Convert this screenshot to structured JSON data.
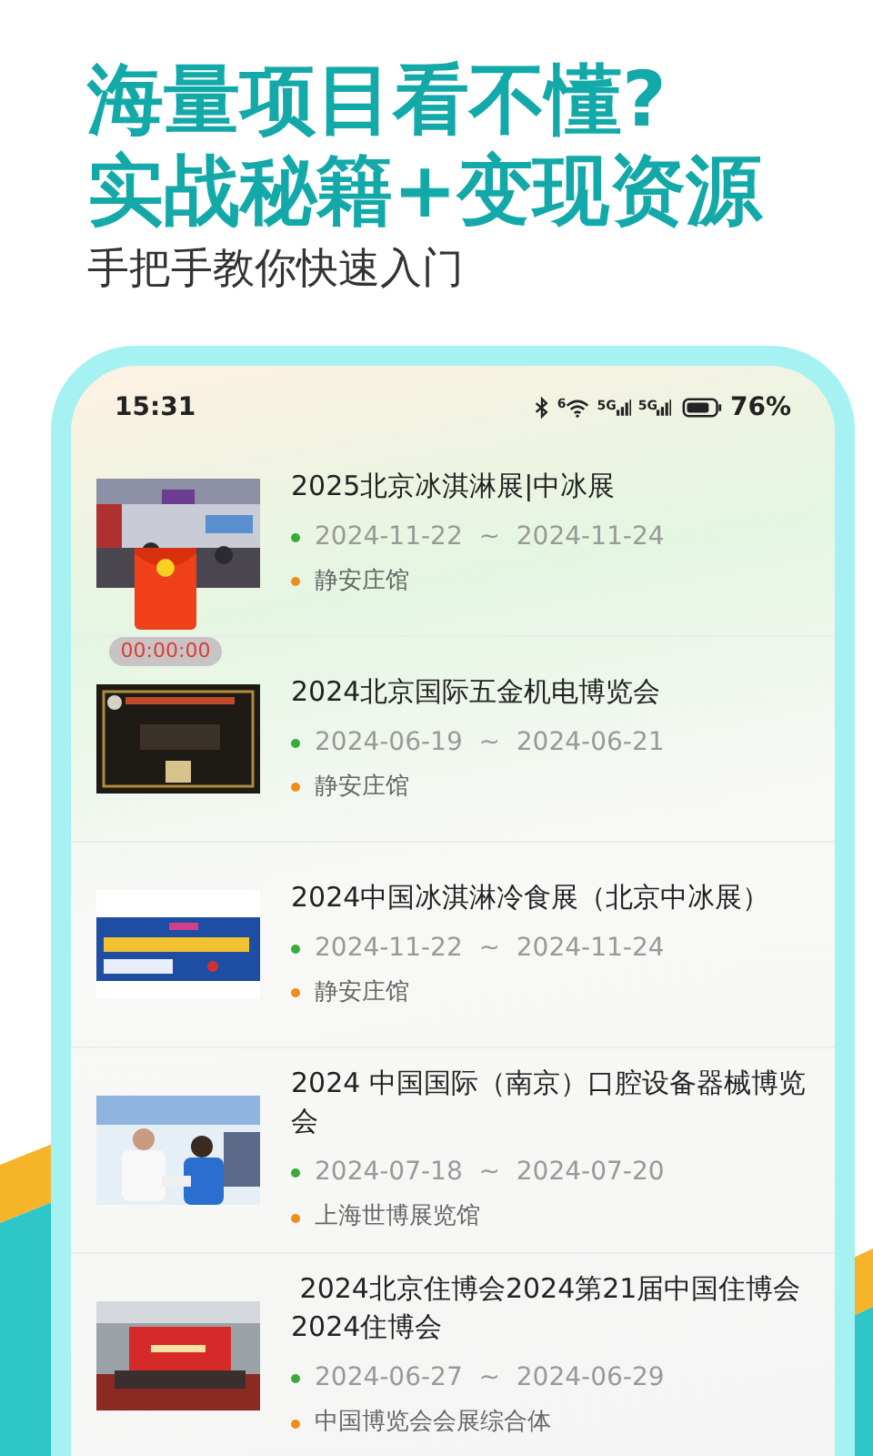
{
  "headline": {
    "lines": [
      "海量项目看不懂?",
      "实战秘籍+变现资源"
    ],
    "subtitle": "手把手教你快速入门"
  },
  "status_bar": {
    "time": "15:31",
    "wifi_badge": "6",
    "signals": [
      "5G",
      "5G"
    ],
    "battery": "76%"
  },
  "events": [
    {
      "title": "2025北京冰淇淋展|中冰展",
      "start": "2024-11-22",
      "separator": "~",
      "end": "2024-11-24",
      "venue": "静安庄馆",
      "red_packet": {
        "timer": "00:00:00"
      }
    },
    {
      "title": "2024北京国际五金机电博览会",
      "start": "2024-06-19",
      "separator": "~",
      "end": "2024-06-21",
      "venue": "静安庄馆"
    },
    {
      "title": "2024中国冰淇淋冷食展（北京中冰展）",
      "start": "2024-11-22",
      "separator": "~",
      "end": "2024-11-24",
      "venue": "静安庄馆"
    },
    {
      "title": "2024 中国国际（南京）口腔设备器械博览会",
      "start": "2024-07-18",
      "separator": "~",
      "end": "2024-07-20",
      "venue": "上海世博展览馆"
    },
    {
      "title": " 2024北京住博会2024第21届中国住博会2024住博会",
      "start": "2024-06-27",
      "separator": "~",
      "end": "2024-06-29",
      "venue": "中国博览会会展综合体"
    }
  ]
}
